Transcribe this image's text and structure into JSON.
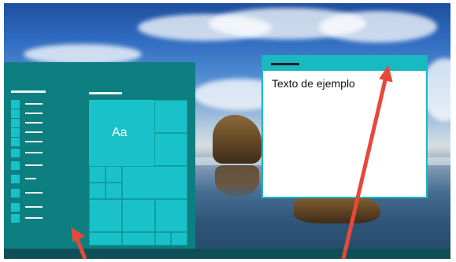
{
  "note_window": {
    "body_text": "Texto de ejemplo"
  },
  "start_menu": {
    "tile_label": "Aa",
    "rows": 10
  },
  "colors": {
    "start_menu_bg": "#0e7f81",
    "tile_accent": "#19c2c8",
    "taskbar": "#0f4f57",
    "arrow": "#e8483a"
  },
  "icons": [
    "menu-square-icon",
    "arrow-icon"
  ]
}
